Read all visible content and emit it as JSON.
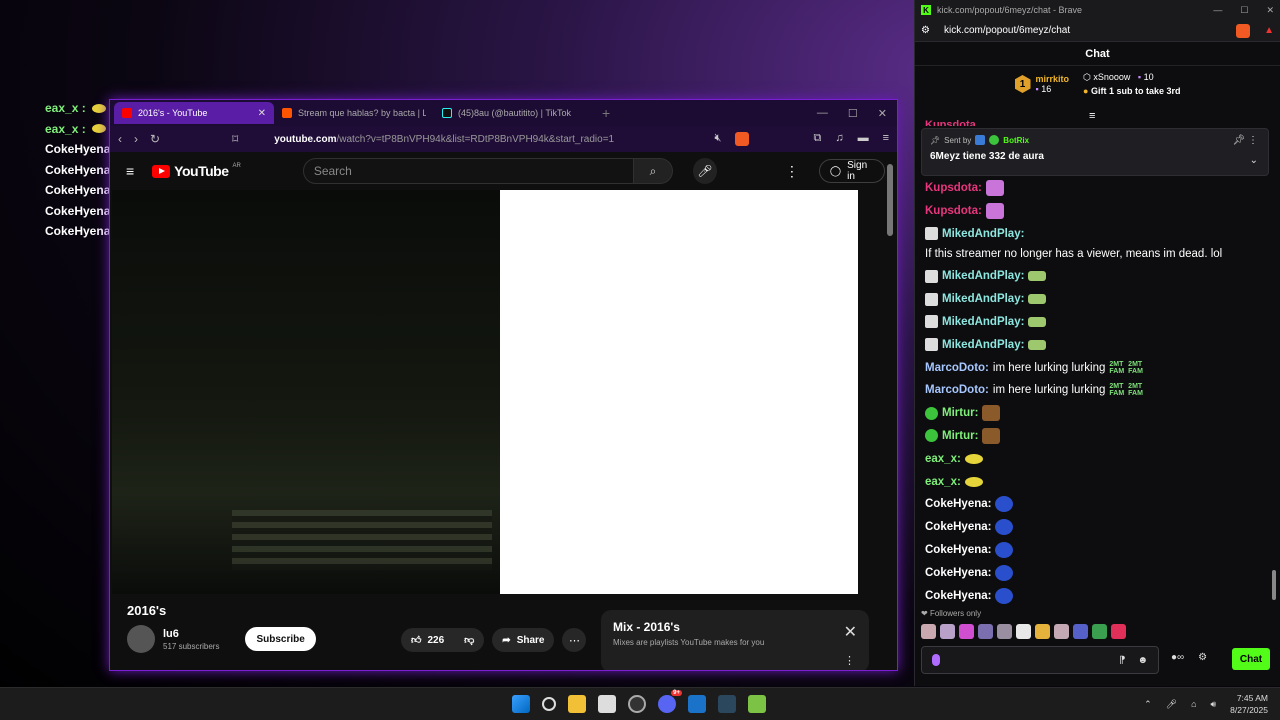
{
  "overlay_chat": [
    {
      "name": "eax_x :",
      "color": "green",
      "emote": "yellow"
    },
    {
      "name": "eax_x :",
      "color": "green",
      "emote": "yellow"
    },
    {
      "name": "CokeHyena :",
      "color": "white",
      "emote": "bot"
    },
    {
      "name": "CokeHyena :",
      "color": "white",
      "emote": "bot"
    },
    {
      "name": "CokeHyena :",
      "color": "white",
      "emote": "bot"
    },
    {
      "name": "CokeHyena :",
      "color": "white",
      "emote": "bot"
    },
    {
      "name": "CokeHyena :",
      "color": "white",
      "emote": "bot"
    }
  ],
  "youtube_browser": {
    "tabs": [
      {
        "label": "2016's - YouTube",
        "active": true
      },
      {
        "label": "Stream que hablas? by bacta | Listen",
        "active": false
      },
      {
        "label": "(45)8au (@bautitito) | TikTok",
        "active": false
      }
    ],
    "url_host": "youtube.com",
    "url_path": "/watch?v=tP8BnVPH94k&list=RDtP8BnVPH94k&start_radio=1",
    "logo_text": "YouTube",
    "logo_region": "AR",
    "search_placeholder": "Search",
    "signin_label": "Sign in",
    "video_title": "2016's",
    "channel_name": "lu6",
    "channel_subs": "517 subscribers",
    "subscribe_label": "Subscribe",
    "like_count": "226",
    "share_label": "Share",
    "mix_title": "Mix - 2016's",
    "mix_subtitle": "Mixes are playlists YouTube makes for you"
  },
  "chat_window": {
    "window_title": "kick.com/popout/6meyz/chat - Brave",
    "url": "kick.com/popout/6meyz/chat",
    "header": "Chat",
    "top_gifter": {
      "name": "mirrkito",
      "count": "16"
    },
    "second": {
      "name": "xSnooow",
      "count": "10"
    },
    "gift_text": "Gift 1 sub to take 3rd",
    "partial_name": "Kupsdota",
    "pinned": {
      "sent_by": "Sent by",
      "bot": "BotRix",
      "text": "6Meyz tiene 332 de aura"
    },
    "messages": [
      {
        "name": "Kupsdota:",
        "color": "#e8357d",
        "text": "",
        "emote": "em-pink"
      },
      {
        "name": "Kupsdota:",
        "color": "#e8357d",
        "text": "",
        "emote": "em-pink"
      },
      {
        "name": "MikedAndPlay:",
        "color": "#8ee6e0",
        "badge": "bdg-mike",
        "text": "If this streamer no longer has a viewer, means im dead. lol",
        "emote": ""
      },
      {
        "name": "MikedAndPlay:",
        "color": "#8ee6e0",
        "badge": "bdg-mike",
        "text": "",
        "emote": "em-green"
      },
      {
        "name": "MikedAndPlay:",
        "color": "#8ee6e0",
        "badge": "bdg-mike",
        "text": "",
        "emote": "em-green"
      },
      {
        "name": "MikedAndPlay:",
        "color": "#8ee6e0",
        "badge": "bdg-mike",
        "text": "",
        "emote": "em-green"
      },
      {
        "name": "MikedAndPlay:",
        "color": "#8ee6e0",
        "badge": "bdg-mike",
        "text": "",
        "emote": "em-green"
      },
      {
        "name": "MarcoDoto:",
        "color": "#a7c7ff",
        "text": "im here lurking lurking",
        "emote": "2mt"
      },
      {
        "name": "MarcoDoto:",
        "color": "#a7c7ff",
        "text": "im here lurking lurking",
        "emote": "2mt"
      },
      {
        "name": "Mirtur:",
        "color": "#7ff07a",
        "badge": "bdg-verified",
        "text": "",
        "emote": "em-brown"
      },
      {
        "name": "Mirtur:",
        "color": "#7ff07a",
        "badge": "bdg-verified",
        "text": "",
        "emote": "em-brown"
      },
      {
        "name": "eax_x:",
        "color": "#7ff07a",
        "text": "",
        "emote": "em-yellow"
      },
      {
        "name": "eax_x:",
        "color": "#7ff07a",
        "text": "",
        "emote": "em-yellow"
      },
      {
        "name": "CokeHyena:",
        "color": "#ffffff",
        "text": "",
        "emote": "em-blue"
      },
      {
        "name": "CokeHyena:",
        "color": "#ffffff",
        "text": "",
        "emote": "em-blue"
      },
      {
        "name": "CokeHyena:",
        "color": "#ffffff",
        "text": "",
        "emote": "em-blue"
      },
      {
        "name": "CokeHyena:",
        "color": "#ffffff",
        "text": "",
        "emote": "em-blue"
      },
      {
        "name": "CokeHyena:",
        "color": "#ffffff",
        "text": "",
        "emote": "em-blue"
      }
    ],
    "emote_2mt_line1": "2MT",
    "emote_2mt_line2": "FAM",
    "followers_only": "Followers only",
    "chat_button": "Chat"
  },
  "taskbar": {
    "time": "7:45 AM",
    "date": "8/27/2025",
    "discord_badge": "9+"
  }
}
